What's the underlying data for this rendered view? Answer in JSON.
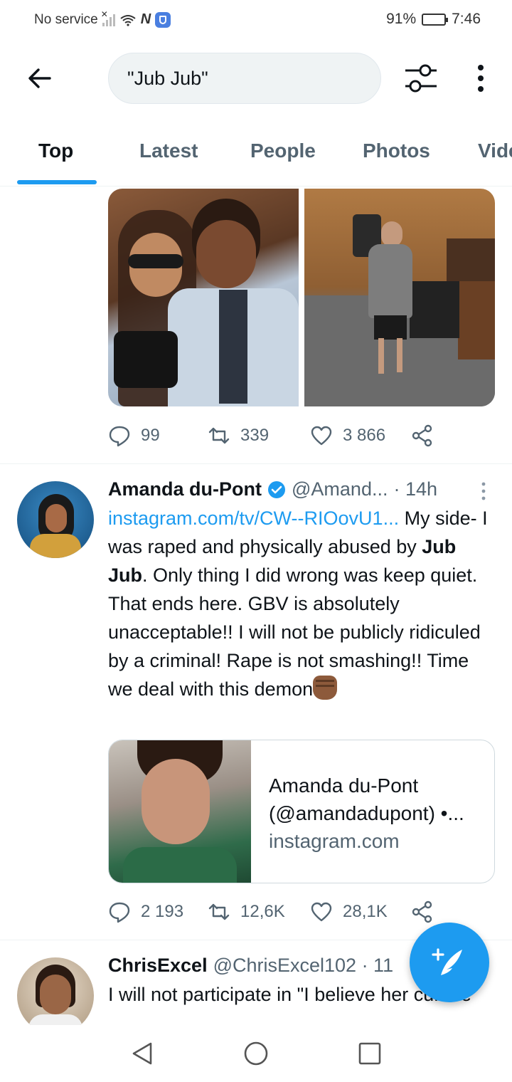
{
  "status_bar": {
    "carrier": "No service",
    "battery": "91%",
    "time": "7:46",
    "battery_level": 0.91
  },
  "header": {
    "search_query": "\"Jub Jub\""
  },
  "tabs": [
    {
      "label": "Top",
      "active": true
    },
    {
      "label": "Latest",
      "active": false
    },
    {
      "label": "People",
      "active": false
    },
    {
      "label": "Photos",
      "active": false
    },
    {
      "label": "Videos",
      "active": false
    }
  ],
  "tweet1": {
    "replies": "99",
    "retweets": "339",
    "likes": "3 866"
  },
  "tweet2": {
    "name": "Amanda du-Pont",
    "handle": "@Amand...",
    "time": "· 14h",
    "link": "instagram.com/tv/CW--RIOovU1...",
    "text_part1": " My side- I was raped and physically abused by ",
    "bold": "Jub Jub",
    "text_part2": ". Only thing I did wrong was keep quiet. That ends here. GBV is absolutely unacceptable!! I will not be publicly ridiculed by a criminal! Rape is not smashing!! Time we deal with this demon",
    "card_title": "Amanda du-Pont",
    "card_subtitle": "(@amandadupont) •...",
    "card_domain": "instagram.com",
    "replies": "2 193",
    "retweets": "12,6K",
    "likes": "28,1K"
  },
  "tweet3": {
    "name": "ChrisExcel",
    "handle": "@ChrisExcel102 · 11",
    "text": "I will not participate in \"I believe her culture"
  },
  "colors": {
    "accent": "#1d9bf0",
    "text": "#0f1419",
    "muted": "#536471"
  }
}
